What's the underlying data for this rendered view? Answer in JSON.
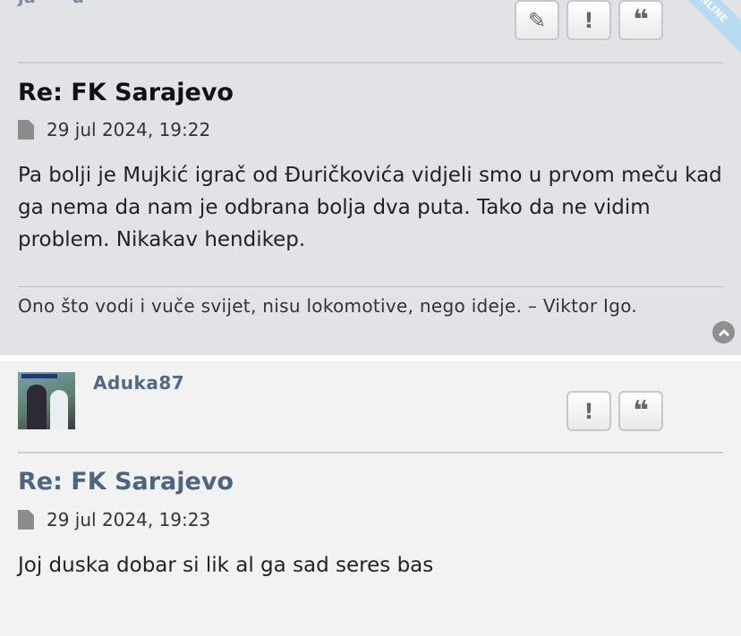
{
  "post1": {
    "author_fragment": "ja~ ~u~~~",
    "online_badge": "ONLINE",
    "title": "Re: FK Sarajevo",
    "timestamp": "29 jul 2024, 19:22",
    "body": "Pa bolji je Mujkić igrač od Đuričkovića vidjeli smo u prvom meču kad ga nema da nam je odbrana bolja dva puta. Tako da ne vidim problem. Nikakav hendikep.",
    "signature": "Ono što vodi i vuče svijet, nisu lokomotive, nego ideje. – Viktor Igo.",
    "buttons": {
      "edit": "✎",
      "report": "!",
      "quote": "❝"
    }
  },
  "post2": {
    "author": "Aduka87",
    "title": "Re: FK Sarajevo",
    "timestamp": "29 jul 2024, 19:23",
    "body": "Joj duska dobar si lik al ga sad seres bas",
    "buttons": {
      "report": "!",
      "quote": "❝"
    }
  },
  "colors": {
    "post1_bg": "#e1e3e7",
    "post2_bg": "#f2f2f2",
    "title_dark": "#111111",
    "title_link": "#4c6680",
    "username": "#4e6a87"
  },
  "icons": [
    "pencil-icon",
    "exclamation-icon",
    "quote-icon",
    "document-icon",
    "arrow-up-icon"
  ]
}
